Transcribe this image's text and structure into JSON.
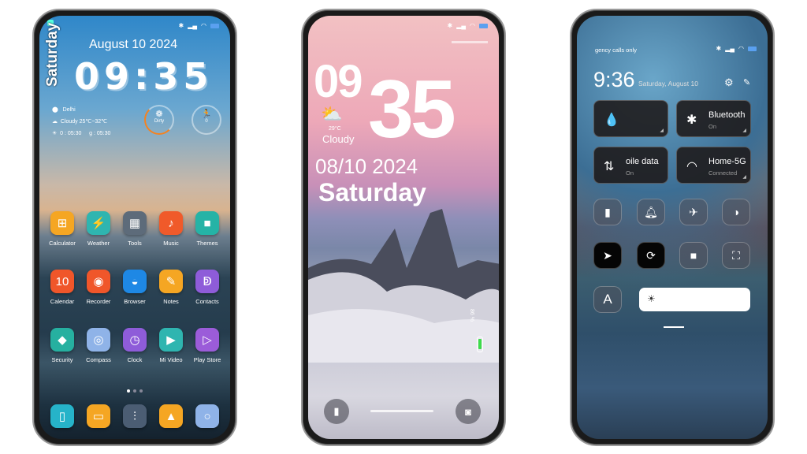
{
  "home": {
    "date": "August 10  2024",
    "time": "09:35",
    "day": "Saturday",
    "location": "Delhi",
    "weather": "Cloudy  25℃~32℃",
    "sunrise": "0 : 05:30",
    "sunset": "g : 05:30",
    "ring1_label": "Dirty",
    "ring2_label": "0",
    "apps": [
      {
        "label": "Calculator",
        "color": "#f5a623",
        "glyph": "⊞"
      },
      {
        "label": "Weather",
        "color": "#2fb5b0",
        "glyph": "⚡"
      },
      {
        "label": "Tools",
        "color": "#5d6b7a",
        "glyph": "▦"
      },
      {
        "label": "Music",
        "color": "#f05a2a",
        "glyph": "♪"
      },
      {
        "label": "Themes",
        "color": "#25b3a6",
        "glyph": "■"
      },
      {
        "label": "Calendar",
        "color": "#f0562a",
        "glyph": "10"
      },
      {
        "label": "Recorder",
        "color": "#f0562a",
        "glyph": "◉"
      },
      {
        "label": "Browser",
        "color": "#1e88e5",
        "glyph": "◒"
      },
      {
        "label": "Notes",
        "color": "#f5a623",
        "glyph": "✎"
      },
      {
        "label": "Contacts",
        "color": "#8e5cd9",
        "glyph": "ↁ"
      },
      {
        "label": "Security",
        "color": "#26b0a0",
        "glyph": "◆"
      },
      {
        "label": "Compass",
        "color": "#8fb3e8",
        "glyph": "◎"
      },
      {
        "label": "Clock",
        "color": "#8e5cd9",
        "glyph": "◷"
      },
      {
        "label": "Mi Video",
        "color": "#2fb5b0",
        "glyph": "▶"
      },
      {
        "label": "Play Store",
        "color": "#9b5cd9",
        "glyph": "▷"
      }
    ],
    "dock": [
      {
        "name": "phone",
        "color": "#26b3c9",
        "glyph": "▯"
      },
      {
        "name": "messages",
        "color": "#f5a623",
        "glyph": "▭"
      },
      {
        "name": "settings",
        "color": "#4b5d73",
        "glyph": "⫶"
      },
      {
        "name": "gallery",
        "color": "#f5a623",
        "glyph": "▲"
      },
      {
        "name": "camera",
        "color": "#8fb3e8",
        "glyph": "○"
      }
    ]
  },
  "lock": {
    "hour": "09",
    "minute": "35",
    "temp": "29°C",
    "weather": "Cloudy",
    "date": "08/10 2024",
    "day": "Saturday",
    "battery": "86 %",
    "battery_level": 86
  },
  "control": {
    "carrier": "gency calls only",
    "time": "9:36",
    "date": "Saturday, August 10",
    "tiles": [
      {
        "title": "",
        "sub": "",
        "icon": "water-drop"
      },
      {
        "title": "Bluetooth",
        "sub": "On",
        "icon": "bluetooth"
      },
      {
        "title": "oile data",
        "sub": "On",
        "icon": "mobile-data"
      },
      {
        "title": "Home-5G",
        "sub": "Connected",
        "icon": "wifi"
      }
    ],
    "font_button": "A",
    "brightness": 1.0
  }
}
